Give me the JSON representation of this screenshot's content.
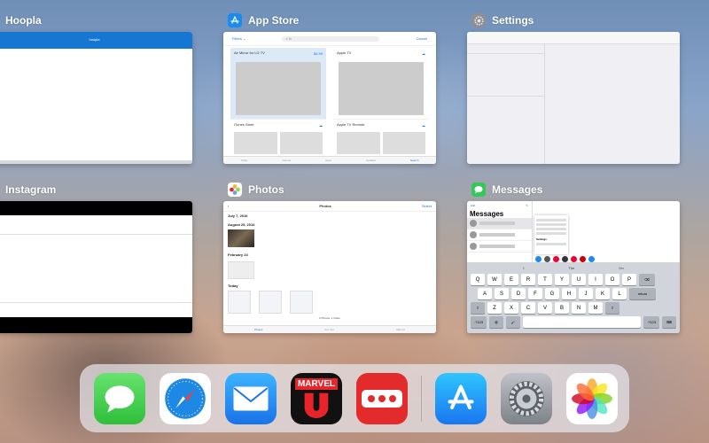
{
  "switcher": {
    "cards": [
      {
        "id": "hoopla",
        "label": "Hoopla",
        "header_text": "hoopla"
      },
      {
        "id": "appstore",
        "label": "App Store",
        "content": {
          "filters": "Filters ⌄",
          "cancel": "Cancel",
          "featured": {
            "name": "Air Mirror for LG TV",
            "price": "$4.99"
          },
          "items": [
            "Apple TV",
            "iTunes Store",
            "Apple TV Remote"
          ],
          "tabs": [
            "Today",
            "Games",
            "Apps",
            "Updates",
            "Search"
          ]
        }
      },
      {
        "id": "settings",
        "label": "Settings"
      },
      {
        "id": "instagram",
        "label": "Instagram"
      },
      {
        "id": "photos",
        "label": "Photos",
        "content": {
          "title": "Photos",
          "select": "Select",
          "sections": [
            "July 7, 2016",
            "August 25, 2016",
            "February 24",
            "Today"
          ],
          "count": "6 Photos, 1 Video",
          "tabs": [
            "Photos",
            "For You",
            "Albums"
          ]
        }
      },
      {
        "id": "messages",
        "label": "Messages",
        "content": {
          "edit": "Edit",
          "title": "Messages",
          "suggestions": [
            "I",
            "The",
            "I'm"
          ],
          "popup_title": "Settings",
          "keyboard": {
            "row1": [
              "Q",
              "W",
              "E",
              "R",
              "T",
              "Y",
              "U",
              "I",
              "O",
              "P"
            ],
            "row2": [
              "A",
              "S",
              "D",
              "F",
              "G",
              "H",
              "J",
              "K",
              "L"
            ],
            "row3": [
              "Z",
              "X",
              "C",
              "V",
              "B",
              "N",
              "M"
            ],
            "return": "return",
            "num": ".?123"
          }
        }
      }
    ]
  },
  "dock": {
    "apps": [
      "messages-app",
      "safari-app",
      "mail-app",
      "marvel-unlimited-app",
      "dots-app",
      "app-store-app",
      "settings-app",
      "photos-app"
    ],
    "marvel_text": "MARVEL"
  },
  "colors": {
    "appstore_blue": "#1a8cf0",
    "messages_green": "#34c759",
    "hoopla_blue": "#1677d2"
  }
}
